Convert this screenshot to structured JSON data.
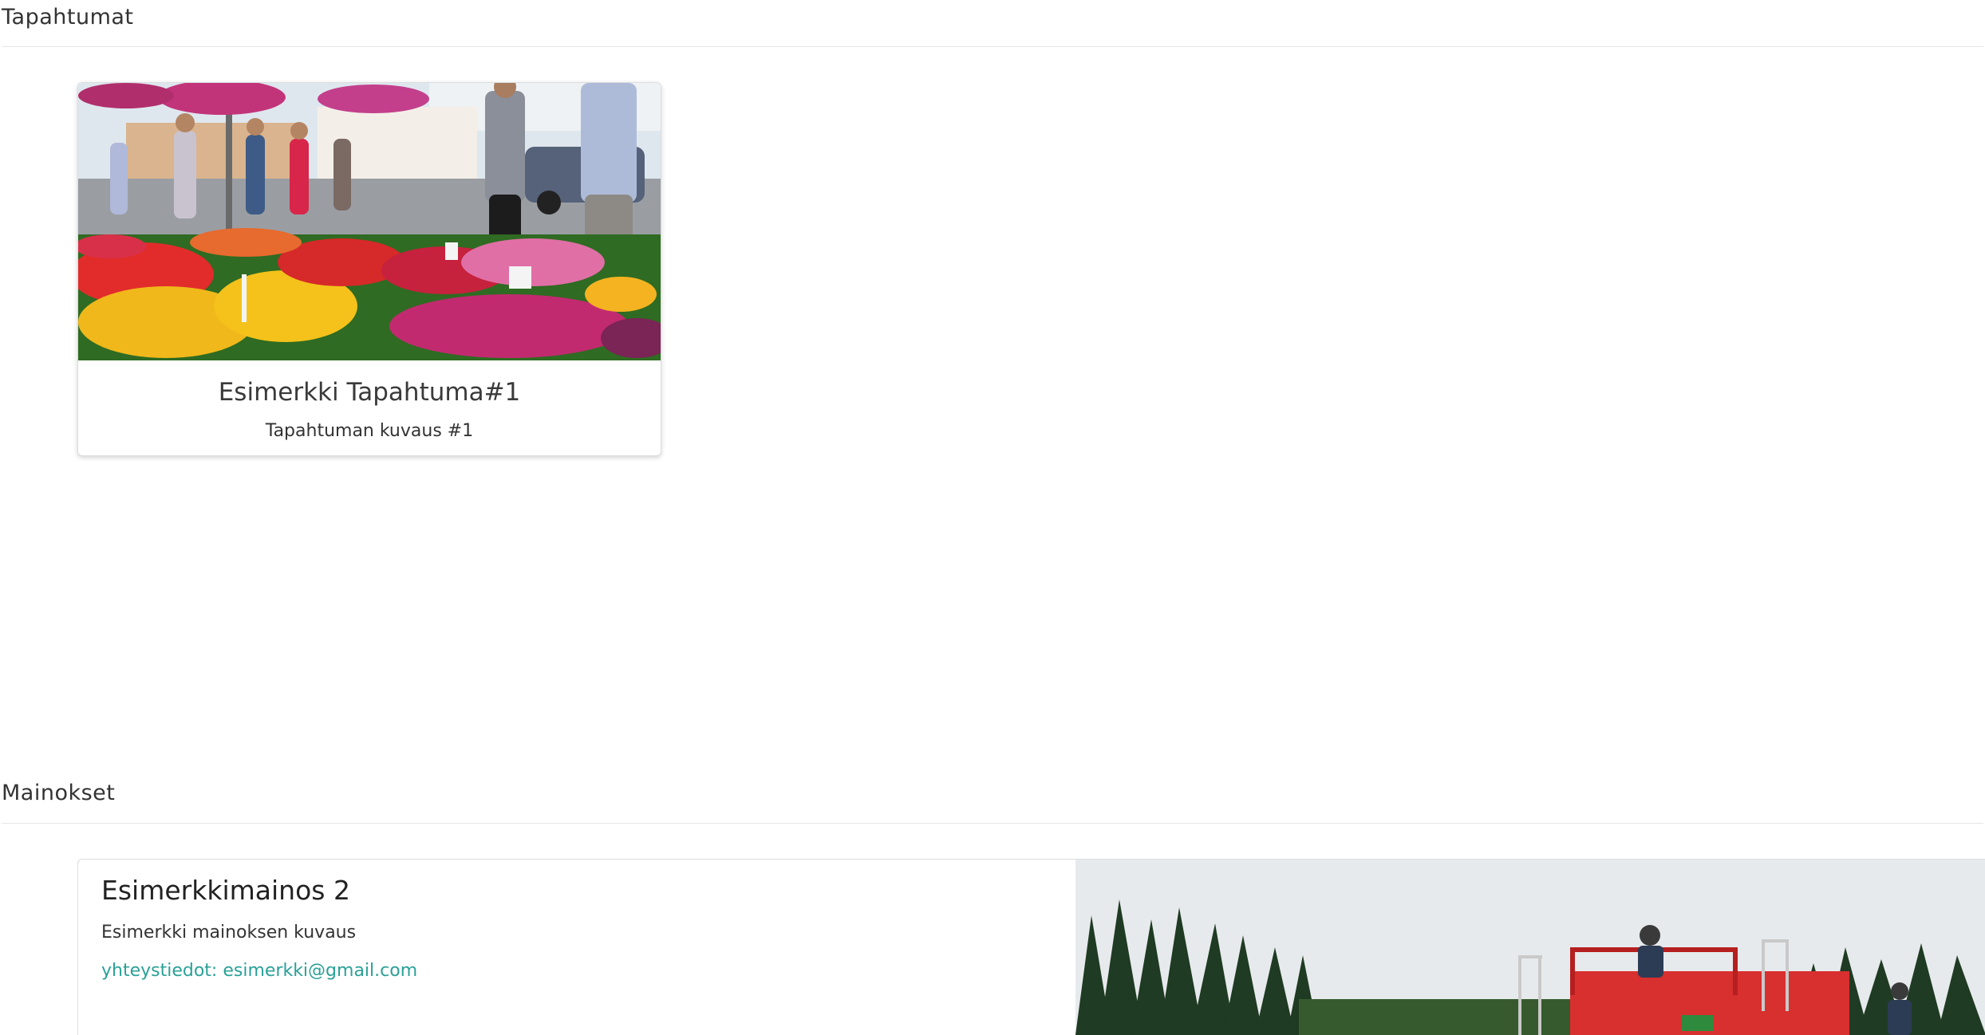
{
  "events_section": {
    "title": "Tapahtumat",
    "cards": [
      {
        "title": "Esimerkki Tapahtuma#1",
        "description": "Tapahtuman kuvaus #1",
        "image": "flower-market-photo"
      }
    ]
  },
  "ads_section": {
    "title": "Mainokset",
    "cards": [
      {
        "title": "Esimerkkimainos 2",
        "description": "Esimerkki mainoksen kuvaus",
        "contact": "yhteystiedot: esimerkki@gmail.com",
        "image": "farm-machinery-photo"
      }
    ]
  },
  "colors": {
    "link": "#2aa198",
    "divider": "#e6e6e6",
    "card_border": "#dddddd"
  }
}
